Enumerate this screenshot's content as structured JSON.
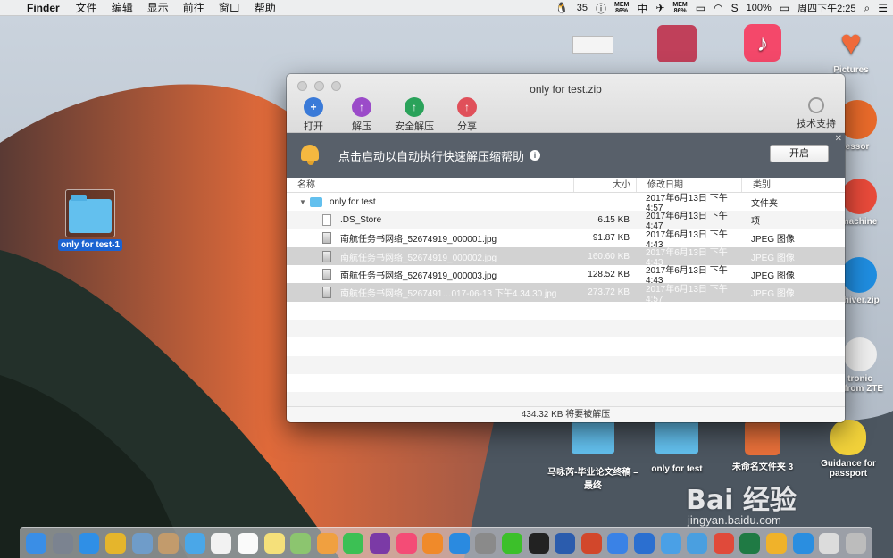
{
  "menubar": {
    "app_name": "Finder",
    "menus": [
      "文件",
      "编辑",
      "显示",
      "前往",
      "窗口",
      "帮助"
    ],
    "qq_count": "35",
    "mem_label_1": "MEM",
    "mem_value_1": "86%",
    "mem_label_2": "MEM",
    "mem_value_2": "86%",
    "battery": "100%",
    "clock": "周四下午2:25"
  },
  "desktop": {
    "left_folder": "only for test-1",
    "right_icons": [
      {
        "label": "Pictures",
        "color": "#f06a3a"
      },
      {
        "label": "essor",
        "color": "#222"
      },
      {
        "label": "machine",
        "color": "#e84a3a"
      },
      {
        "label": "chiver.zip",
        "color": "#1f8de0"
      },
      {
        "label": "tronic\n...from ZTE",
        "color": "#ddd"
      }
    ],
    "bottom_icons": [
      {
        "label": "马咏芮-毕业论文终稿 – 最终"
      },
      {
        "label": "only for test"
      },
      {
        "label": "未命名文件夹 3"
      },
      {
        "label": "Guidance for passport"
      }
    ]
  },
  "window": {
    "title": "only for test.zip",
    "toolbar": [
      {
        "label": "打开",
        "icon": "open-icon",
        "color": "#3a7ad8"
      },
      {
        "label": "解压",
        "icon": "extract-icon",
        "color": "#9b4bc9"
      },
      {
        "label": "安全解压",
        "icon": "safe-extract-icon",
        "color": "#2aa25a"
      },
      {
        "label": "分享",
        "icon": "share-icon",
        "color": "#e0505a"
      }
    ],
    "support_label": "技术支持",
    "banner_text": "点击启动以自动执行快速解压缩帮助",
    "banner_button": "开启",
    "columns": {
      "name": "名称",
      "size": "大小",
      "date": "修改日期",
      "kind": "类别"
    },
    "rows": [
      {
        "name": "only for test",
        "size": "",
        "date": "2017年6月13日 下午4:57",
        "kind": "文件夹",
        "type": "folder",
        "dim": false
      },
      {
        "name": ".DS_Store",
        "size": "6.15 KB",
        "date": "2017年6月13日 下午4:47",
        "kind": "项",
        "type": "doc",
        "dim": false
      },
      {
        "name": "南航任务书网络_52674919_000001.jpg",
        "size": "91.87 KB",
        "date": "2017年6月13日 下午4:43",
        "kind": "JPEG 图像",
        "type": "jpg",
        "dim": false
      },
      {
        "name": "南航任务书网络_52674919_000002.jpg",
        "size": "160.60 KB",
        "date": "2017年6月13日 下午4:43",
        "kind": "JPEG 图像",
        "type": "jpg",
        "dim": true
      },
      {
        "name": "南航任务书网络_52674919_000003.jpg",
        "size": "128.52 KB",
        "date": "2017年6月13日 下午4:43",
        "kind": "JPEG 图像",
        "type": "jpg",
        "dim": false
      },
      {
        "name": "南航任务书网络_5267491…017-06-13 下午4.34.30.jpg",
        "size": "273.72 KB",
        "date": "2017年6月13日 下午4:57",
        "kind": "JPEG 图像",
        "type": "jpg",
        "dim": true
      }
    ],
    "status": "434.32 KB 将要被解压"
  },
  "dock": {
    "apps": [
      {
        "name": "finder",
        "color": "#3a8ee6"
      },
      {
        "name": "launchpad",
        "color": "#7b8390"
      },
      {
        "name": "safari",
        "color": "#2f8fe6"
      },
      {
        "name": "chrome",
        "color": "#e5b52c"
      },
      {
        "name": "preview",
        "color": "#6f9cc9"
      },
      {
        "name": "contacts",
        "color": "#c29b6c"
      },
      {
        "name": "messages-qq",
        "color": "#4aa7e8"
      },
      {
        "name": "calendar",
        "color": "#f2f2f2"
      },
      {
        "name": "reminders",
        "color": "#fafafa"
      },
      {
        "name": "notes",
        "color": "#f5e07a"
      },
      {
        "name": "maps",
        "color": "#8cc56f"
      },
      {
        "name": "photos",
        "color": "#f0a040"
      },
      {
        "name": "facetime",
        "color": "#3cc054"
      },
      {
        "name": "onenote",
        "color": "#7b3aa6"
      },
      {
        "name": "itunes",
        "color": "#f44c76"
      },
      {
        "name": "ibooks",
        "color": "#f08a2a"
      },
      {
        "name": "app-store",
        "color": "#2a8ae0"
      },
      {
        "name": "system-preferences",
        "color": "#8a8a8a"
      },
      {
        "name": "wechat",
        "color": "#3cc02a"
      },
      {
        "name": "qq",
        "color": "#222"
      },
      {
        "name": "word",
        "color": "#2b5cad"
      },
      {
        "name": "powerpoint",
        "color": "#d2472b"
      },
      {
        "name": "baidu-netdisk",
        "color": "#3a82e6"
      },
      {
        "name": "browser",
        "color": "#2b6fd0"
      },
      {
        "name": "flight",
        "color": "#4aa0e6"
      },
      {
        "name": "bird",
        "color": "#4a9fe0"
      },
      {
        "name": "mail",
        "color": "#e04a3a"
      },
      {
        "name": "excel",
        "color": "#1f7a44"
      },
      {
        "name": "sketch",
        "color": "#f0b22a"
      },
      {
        "name": "archiver",
        "color": "#2a8ee0"
      },
      {
        "name": "preview-docs",
        "color": "#dcdcdc"
      },
      {
        "name": "trash",
        "color": "#bcbcbc"
      }
    ]
  },
  "watermark": {
    "brand": "Bai 经验",
    "url": "jingyan.baidu.com"
  }
}
